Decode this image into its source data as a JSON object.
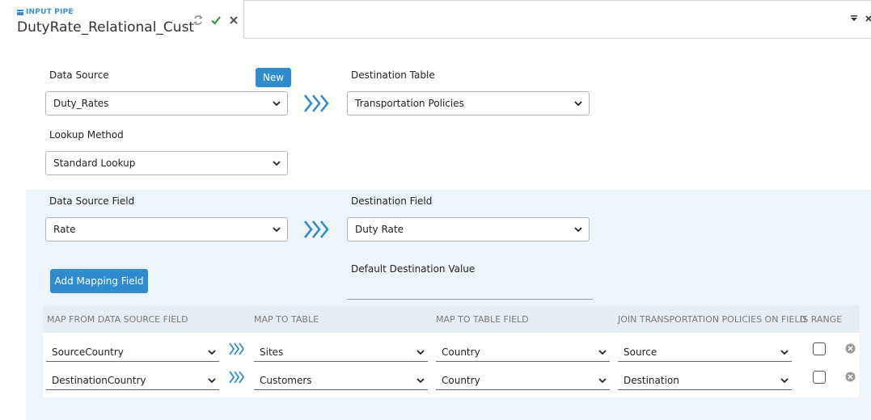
{
  "tab": {
    "type_label": "INPUT PIPE",
    "title": "DutyRate_Relational_Cust"
  },
  "form": {
    "data_source_label": "Data Source",
    "new_button": "New",
    "data_source_value": "Duty_Rates",
    "destination_table_label": "Destination Table",
    "destination_table_value": "Transportation Policies",
    "lookup_method_label": "Lookup Method",
    "lookup_method_value": "Standard Lookup"
  },
  "mapping": {
    "data_source_field_label": "Data Source Field",
    "data_source_field_value": "Rate",
    "destination_field_label": "Destination Field",
    "destination_field_value": "Duty Rate",
    "add_mapping_button": "Add Mapping Field",
    "default_destination_label": "Default Destination Value",
    "default_destination_value": ""
  },
  "table": {
    "headers": {
      "from": "MAP FROM DATA SOURCE FIELD",
      "to_table": "MAP TO TABLE",
      "to_field": "MAP TO TABLE FIELD",
      "join": "JOIN TRANSPORTATION POLICIES ON FIELD",
      "range": "IS RANGE"
    },
    "rows": [
      {
        "from": "SourceCountry",
        "to_table": "Sites",
        "to_field": "Country",
        "join": "Source",
        "is_range": false
      },
      {
        "from": "DestinationCountry",
        "to_table": "Customers",
        "to_field": "Country",
        "join": "Destination",
        "is_range": false
      }
    ]
  },
  "colors": {
    "accent": "#2f8ccf",
    "check": "#2e9b48",
    "panel": "#eef5fa"
  }
}
